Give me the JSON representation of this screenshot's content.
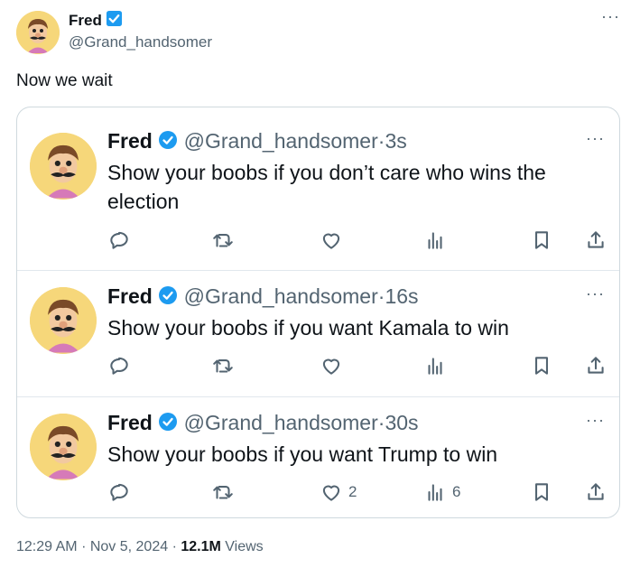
{
  "outer": {
    "author": {
      "name": "Fred",
      "handle": "@Grand_handsomer"
    },
    "more": "···",
    "text": "Now we wait",
    "footer": {
      "time": "12:29 AM",
      "sep1": "·",
      "date": "Nov 5, 2024",
      "sep2": "·",
      "views_count": "12.1M",
      "views_label": "Views"
    }
  },
  "quoted": [
    {
      "name": "Fred",
      "handle": "@Grand_handsomer",
      "dot": "·",
      "time": "3s",
      "text": "Show your boobs if you don’t care who wins the election",
      "likes": "",
      "views": ""
    },
    {
      "name": "Fred",
      "handle": "@Grand_handsomer",
      "dot": "·",
      "time": "16s",
      "text": "Show your boobs if you want Kamala to win",
      "likes": "",
      "views": ""
    },
    {
      "name": "Fred",
      "handle": "@Grand_handsomer",
      "dot": "·",
      "time": "30s",
      "text": "Show your boobs if you want Trump to win",
      "likes": "2",
      "views": "6"
    }
  ],
  "icons": {
    "verified_outer": "verified-badge-square-blue",
    "verified_inner": "verified-badge-blue",
    "reply": "reply-icon",
    "retweet": "retweet-icon",
    "like": "like-icon",
    "views": "views-icon",
    "bookmark": "bookmark-icon",
    "share": "share-icon"
  },
  "colors": {
    "verified": "#1d9bf0",
    "muted": "#536471",
    "text": "#0f1419",
    "border": "#cfd9de",
    "avatar_bg": "#f6d77a"
  }
}
